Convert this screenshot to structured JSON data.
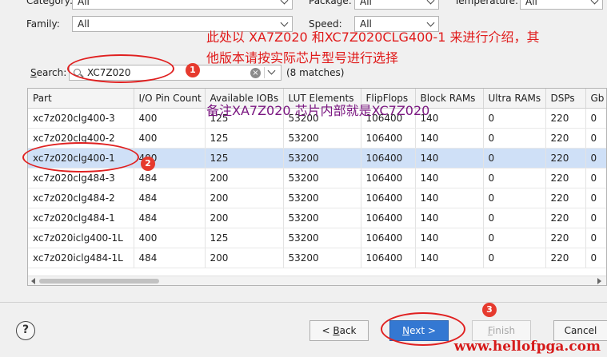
{
  "filters": {
    "category_label": "Category:",
    "category_value": "All",
    "package_label": "Package:",
    "package_value": "All",
    "temperature_label": "Temperature:",
    "temperature_value": "All",
    "family_label": "Family:",
    "family_value": "All",
    "speed_label": "Speed:",
    "speed_value": "All"
  },
  "search": {
    "label": "Search:",
    "label_underline_char": "S",
    "label_rest": "earch:",
    "value": "XC7Z020",
    "matches": "(8 matches)"
  },
  "table": {
    "columns": [
      "Part",
      "I/O Pin Count",
      "Available IOBs",
      "LUT Elements",
      "FlipFlops",
      "Block RAMs",
      "Ultra RAMs",
      "DSPs",
      "Gb"
    ],
    "rows": [
      [
        "xc7z020clg400-3",
        "400",
        "125",
        "53200",
        "106400",
        "140",
        "0",
        "220",
        "0"
      ],
      [
        "xc7z020clg400-2",
        "400",
        "125",
        "53200",
        "106400",
        "140",
        "0",
        "220",
        "0"
      ],
      [
        "xc7z020clg400-1",
        "400",
        "125",
        "53200",
        "106400",
        "140",
        "0",
        "220",
        "0"
      ],
      [
        "xc7z020clg484-3",
        "484",
        "200",
        "53200",
        "106400",
        "140",
        "0",
        "220",
        "0"
      ],
      [
        "xc7z020clg484-2",
        "484",
        "200",
        "53200",
        "106400",
        "140",
        "0",
        "220",
        "0"
      ],
      [
        "xc7z020clg484-1",
        "484",
        "200",
        "53200",
        "106400",
        "140",
        "0",
        "220",
        "0"
      ],
      [
        "xc7z020iclg400-1L",
        "400",
        "125",
        "53200",
        "106400",
        "140",
        "0",
        "220",
        "0"
      ],
      [
        "xc7z020iclg484-1L",
        "484",
        "200",
        "53200",
        "106400",
        "140",
        "0",
        "220",
        "0"
      ]
    ],
    "selected_row": 2
  },
  "buttons": {
    "help": "?",
    "back_prefix": "< ",
    "back_ul": "B",
    "back_rest": "ack",
    "next_ul": "N",
    "next_rest": "ext >",
    "finish_ul": "F",
    "finish_rest": "inish",
    "cancel": "Cancel"
  },
  "annotations": {
    "note_line1": "此处以 XA7Z020  和XC7Z020CLG400-1 来进行介绍，其",
    "note_line2": "他版本请按实际芯片型号进行选择",
    "note_purple": "备注XA7Z020  芯片内部就是XC7Z020",
    "badge_1": "1",
    "badge_2": "2",
    "badge_3": "3",
    "watermark": "www.hellofpga.com"
  },
  "colors": {
    "accent": "#3478d2",
    "selection": "#cfe0f7",
    "annotation_red": "#e01a1a",
    "annotation_purple": "#7a1680"
  }
}
